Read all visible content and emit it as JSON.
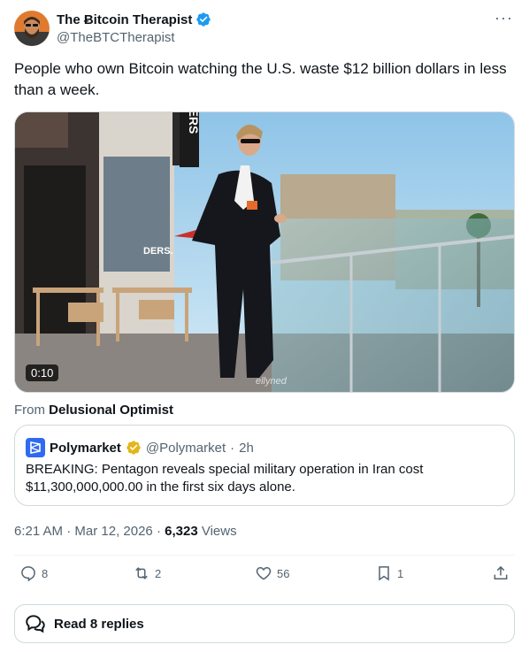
{
  "author": {
    "display_name": "The Ƀitcoin Therapist",
    "handle": "@TheBTCTherapist",
    "verified": true
  },
  "more_label": "···",
  "tweet_text": "People who own Bitcoin watching the U.S. waste $12 billion dollars in less than a week.",
  "media": {
    "duration": "0:10",
    "sign_text": "ERS",
    "store_text": "DERS.",
    "watermark": "ellyned"
  },
  "from": {
    "prefix": "From",
    "source": "Delusional Optimist"
  },
  "quote": {
    "name": "Polymarket",
    "handle": "@Polymarket",
    "separator": "·",
    "time": "2h",
    "text": "BREAKING: Pentagon reveals special military operation in Iran cost $11,300,000,000.00 in the first six days alone."
  },
  "meta": {
    "time": "6:21 AM",
    "sep1": "·",
    "date": "Mar 12, 2026",
    "sep2": "·",
    "views_count": "6,323",
    "views_label": "Views"
  },
  "actions": {
    "replies": "8",
    "reposts": "2",
    "likes": "56",
    "bookmarks": "1"
  },
  "read_replies": "Read 8 replies",
  "colors": {
    "verified_blue": "#1d9bf0",
    "gold_badge": "#e2b719",
    "polymarket_blue": "#2f6bf0",
    "secondary_text": "#536471"
  }
}
